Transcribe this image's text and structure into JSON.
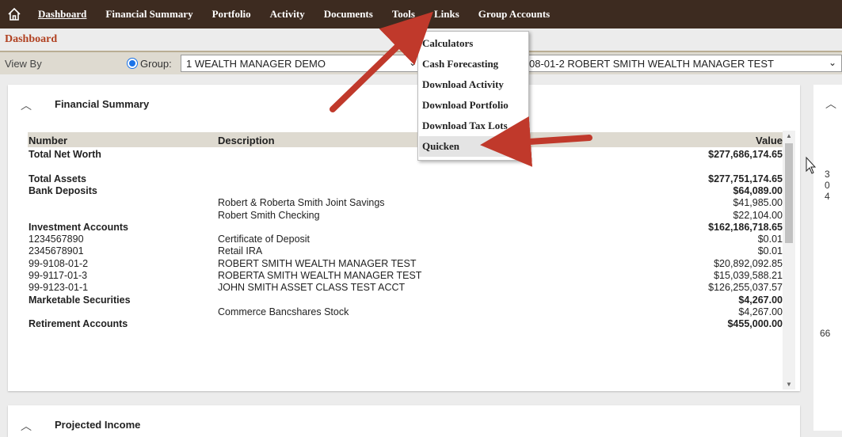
{
  "nav": {
    "items": [
      "Dashboard",
      "Financial Summary",
      "Portfolio",
      "Activity",
      "Documents",
      "Tools",
      "Links",
      "Group Accounts"
    ]
  },
  "page_heading": "Dashboard",
  "view_by": {
    "label": "View By",
    "group_label": "Group:",
    "group_value": "1 WEALTH MANAGER DEMO",
    "account_value": "08-01-2 ROBERT SMITH WEALTH MANAGER TEST"
  },
  "tools_menu": {
    "items": [
      "Calculators",
      "Cash Forecasting",
      "Download Activity",
      "Download Portfolio",
      "Download Tax Lots",
      "Quicken"
    ],
    "highlighted": "Quicken"
  },
  "financial_summary": {
    "title": "Financial Summary",
    "columns": {
      "number": "Number",
      "description": "Description",
      "value": "Value"
    },
    "rows": [
      {
        "number": "Total Net Worth",
        "description": "",
        "value": "$277,686,174.65",
        "bold": true
      },
      {
        "number": "",
        "description": "",
        "value": "",
        "bold": false
      },
      {
        "number": "Total Assets",
        "description": "",
        "value": "$277,751,174.65",
        "bold": true
      },
      {
        "number": "Bank Deposits",
        "description": "",
        "value": "$64,089.00",
        "bold": true
      },
      {
        "number": "",
        "description": "Robert & Roberta Smith Joint Savings",
        "value": "$41,985.00",
        "bold": false
      },
      {
        "number": "",
        "description": "Robert Smith Checking",
        "value": "$22,104.00",
        "bold": false
      },
      {
        "number": "Investment Accounts",
        "description": "",
        "value": "$162,186,718.65",
        "bold": true
      },
      {
        "number": "1234567890",
        "description": "Certificate of Deposit",
        "value": "$0.01",
        "bold": false
      },
      {
        "number": "2345678901",
        "description": "Retail IRA",
        "value": "$0.01",
        "bold": false
      },
      {
        "number": "99-9108-01-2",
        "description": "ROBERT SMITH WEALTH MANAGER TEST",
        "value": "$20,892,092.85",
        "bold": false
      },
      {
        "number": "99-9117-01-3",
        "description": "ROBERTA SMITH WEALTH MANAGER TEST",
        "value": "$15,039,588.21",
        "bold": false
      },
      {
        "number": "99-9123-01-1",
        "description": "JOHN SMITH ASSET CLASS TEST ACCT",
        "value": "$126,255,037.57",
        "bold": false
      },
      {
        "number": "Marketable Securities",
        "description": "",
        "value": "$4,267.00",
        "bold": true
      },
      {
        "number": "",
        "description": "Commerce Bancshares Stock",
        "value": "$4,267.00",
        "bold": false
      },
      {
        "number": "Retirement Accounts",
        "description": "",
        "value": "$455,000.00",
        "bold": true
      }
    ]
  },
  "projected_income": {
    "title": "Projected Income"
  },
  "right_panel": {
    "texts": [
      "3",
      "0",
      "4",
      "66"
    ]
  },
  "colors": {
    "nav_bg": "#3d2b20",
    "heading": "#b04020",
    "arrow": "#c0392b",
    "filter_bg": "#dedad0"
  }
}
